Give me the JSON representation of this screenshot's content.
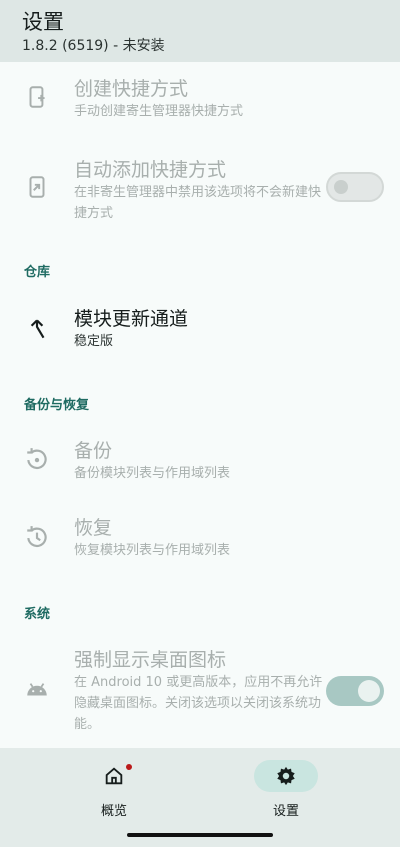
{
  "appbar": {
    "title": "设置",
    "subtitle": "1.8.2 (6519) - 未安装"
  },
  "prefs": {
    "create_shortcut": {
      "title": "创建快捷方式",
      "summary": "手动创建寄生管理器快捷方式",
      "icon": "add-to-home-icon"
    },
    "auto_shortcut": {
      "title": "自动添加快捷方式",
      "summary": "在非寄生管理器中禁用该选项将不会新建快捷方式",
      "icon": "shortcut-icon",
      "enabled": false
    },
    "section_repo": "仓库",
    "update_channel": {
      "title": "模块更新通道",
      "summary": "稳定版",
      "icon": "merge-icon"
    },
    "section_backup": "备份与恢复",
    "backup": {
      "title": "备份",
      "summary": "备份模块列表与作用域列表",
      "icon": "backup-icon"
    },
    "restore": {
      "title": "恢复",
      "summary": "恢复模块列表与作用域列表",
      "icon": "restore-icon"
    },
    "section_system": "系统",
    "force_icon": {
      "title": "强制显示桌面图标",
      "summary": "在 Android 10 或更高版本，应用不再允许隐藏桌面图标。关闭该选项以关闭该系统功能。",
      "icon": "android-icon",
      "enabled": true
    }
  },
  "nav": {
    "overview": {
      "label": "概览",
      "icon": "home-icon",
      "badge": true
    },
    "settings": {
      "label": "设置",
      "icon": "gear-icon",
      "active": true
    }
  },
  "colors": {
    "accent": "#1f6b62",
    "appbar_bg": "#dee7e5",
    "nav_bg": "#e3ebe9",
    "active_pill": "#c9e5e0"
  }
}
